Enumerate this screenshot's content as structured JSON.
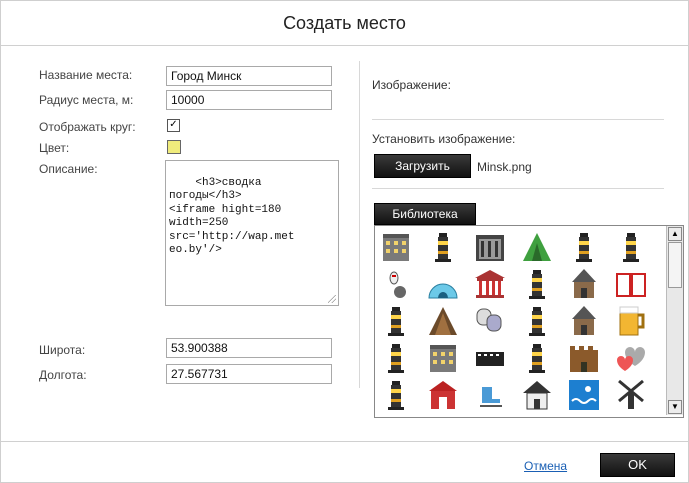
{
  "dialog": {
    "title": "Создать место"
  },
  "form": {
    "name_label": "Название места:",
    "name_value": "Город Минск",
    "radius_label": "Радиус места, м:",
    "radius_value": "10000",
    "show_circle_label": "Отображать круг:",
    "show_circle_checked": true,
    "show_circle_mark": "✓",
    "color_label": "Цвет:",
    "color_value": "#f0ec7c",
    "description_label": "Описание:",
    "description_value": "<h3>сводка\nпогоды</h3>\n<iframe hight=180\nwidth=250\nsrc='http://wap.met\neo.by'/>",
    "latitude_label": "Широта:",
    "latitude_value": "53.900388",
    "longitude_label": "Долгота:",
    "longitude_value": "27.567731"
  },
  "image_panel": {
    "image_label": "Изображение:",
    "set_image_label": "Установить изображение:",
    "upload_button": "Загрузить",
    "file_name": "Minsk.png",
    "library_tab": "Библиотека"
  },
  "library_icons": [
    "building-icon",
    "lighthouse-icon",
    "bank-icon",
    "tent-icon",
    "lighthouse-icon",
    "lighthouse-icon",
    "bowling-icon",
    "igloo-icon",
    "museum-icon",
    "lighthouse-icon",
    "church-icon",
    "book-icon",
    "lighthouse-icon",
    "camping-icon",
    "theater-icon",
    "lighthouse-icon",
    "church-icon",
    "beer-icon",
    "lighthouse-icon",
    "building-icon",
    "cinema-icon",
    "lighthouse-icon",
    "castle-icon",
    "hearts-icon",
    "lighthouse-icon",
    "barn-icon",
    "skating-icon",
    "house-icon",
    "swimming-icon",
    "windmill-icon"
  ],
  "footer": {
    "cancel_label": "Отмена",
    "ok_label": "OK"
  }
}
